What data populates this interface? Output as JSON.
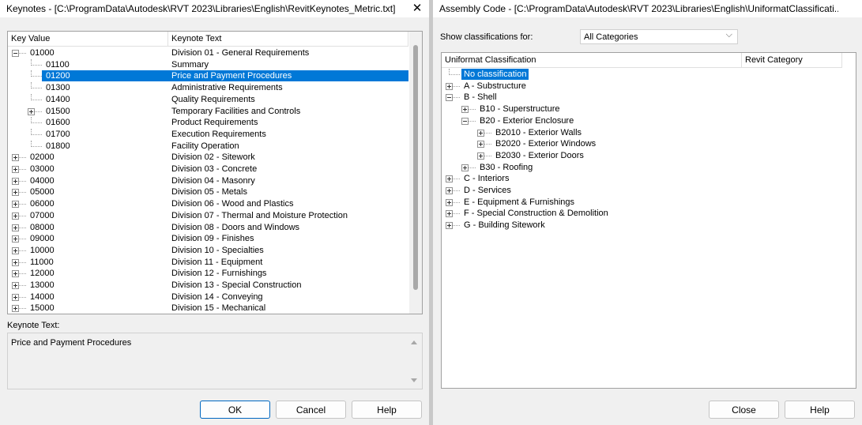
{
  "left": {
    "title": "Keynotes - [C:\\ProgramData\\Autodesk\\RVT 2023\\Libraries\\English\\RevitKeynotes_Metric.txt]",
    "columns": {
      "key": "Key Value",
      "text": "Keynote Text"
    },
    "rows": [
      {
        "key": "01000",
        "text": "Division 01 - General Requirements",
        "level": 0,
        "expander": "minus"
      },
      {
        "key": "01100",
        "text": "Summary",
        "level": 1,
        "expander": ""
      },
      {
        "key": "01200",
        "text": "Price and Payment Procedures",
        "level": 1,
        "expander": "",
        "selected": true
      },
      {
        "key": "01300",
        "text": "Administrative Requirements",
        "level": 1,
        "expander": ""
      },
      {
        "key": "01400",
        "text": "Quality Requirements",
        "level": 1,
        "expander": ""
      },
      {
        "key": "01500",
        "text": "Temporary Facilities and Controls",
        "level": 1,
        "expander": "plus"
      },
      {
        "key": "01600",
        "text": "Product Requirements",
        "level": 1,
        "expander": ""
      },
      {
        "key": "01700",
        "text": "Execution Requirements",
        "level": 1,
        "expander": ""
      },
      {
        "key": "01800",
        "text": "Facility Operation",
        "level": 1,
        "expander": ""
      },
      {
        "key": "02000",
        "text": "Division 02 - Sitework",
        "level": 0,
        "expander": "plus"
      },
      {
        "key": "03000",
        "text": "Division 03 - Concrete",
        "level": 0,
        "expander": "plus"
      },
      {
        "key": "04000",
        "text": "Division 04 - Masonry",
        "level": 0,
        "expander": "plus"
      },
      {
        "key": "05000",
        "text": "Division 05 - Metals",
        "level": 0,
        "expander": "plus"
      },
      {
        "key": "06000",
        "text": "Division 06 - Wood and Plastics",
        "level": 0,
        "expander": "plus"
      },
      {
        "key": "07000",
        "text": "Division 07 - Thermal and Moisture Protection",
        "level": 0,
        "expander": "plus"
      },
      {
        "key": "08000",
        "text": "Division 08 - Doors and Windows",
        "level": 0,
        "expander": "plus"
      },
      {
        "key": "09000",
        "text": "Division 09 - Finishes",
        "level": 0,
        "expander": "plus"
      },
      {
        "key": "10000",
        "text": "Division 10 - Specialties",
        "level": 0,
        "expander": "plus"
      },
      {
        "key": "11000",
        "text": "Division 11 - Equipment",
        "level": 0,
        "expander": "plus"
      },
      {
        "key": "12000",
        "text": "Division 12 - Furnishings",
        "level": 0,
        "expander": "plus"
      },
      {
        "key": "13000",
        "text": "Division 13 - Special Construction",
        "level": 0,
        "expander": "plus"
      },
      {
        "key": "14000",
        "text": "Division 14 - Conveying",
        "level": 0,
        "expander": "plus"
      },
      {
        "key": "15000",
        "text": "Division 15 - Mechanical",
        "level": 0,
        "expander": "plus"
      }
    ],
    "keynote_text_label": "Keynote Text:",
    "keynote_text_value": "Price and Payment Procedures",
    "buttons": {
      "ok": "OK",
      "cancel": "Cancel",
      "help": "Help"
    }
  },
  "right": {
    "title": "Assembly Code - [C:\\ProgramData\\Autodesk\\RVT 2023\\Libraries\\English\\UniformatClassificati...",
    "show_label": "Show classifications for:",
    "show_value": "All Categories",
    "columns": {
      "classification": "Uniformat Classification",
      "category": "Revit Category"
    },
    "rows": [
      {
        "text": "No classification",
        "level": 0,
        "expander": "",
        "selected": true
      },
      {
        "text": "A - Substructure",
        "level": 0,
        "expander": "plus"
      },
      {
        "text": "B - Shell",
        "level": 0,
        "expander": "minus"
      },
      {
        "text": "B10 - Superstructure",
        "level": 1,
        "expander": "plus"
      },
      {
        "text": "B20 - Exterior Enclosure",
        "level": 1,
        "expander": "minus"
      },
      {
        "text": "B2010 - Exterior Walls",
        "level": 2,
        "expander": "plus"
      },
      {
        "text": "B2020 - Exterior Windows",
        "level": 2,
        "expander": "plus"
      },
      {
        "text": "B2030 - Exterior Doors",
        "level": 2,
        "expander": "plus"
      },
      {
        "text": "B30 - Roofing",
        "level": 1,
        "expander": "plus"
      },
      {
        "text": "C - Interiors",
        "level": 0,
        "expander": "plus"
      },
      {
        "text": "D - Services",
        "level": 0,
        "expander": "plus"
      },
      {
        "text": "E - Equipment & Furnishings",
        "level": 0,
        "expander": "plus"
      },
      {
        "text": "F - Special Construction & Demolition",
        "level": 0,
        "expander": "plus"
      },
      {
        "text": "G - Building Sitework",
        "level": 0,
        "expander": "plus"
      }
    ],
    "buttons": {
      "close": "Close",
      "help": "Help"
    }
  },
  "colors": {
    "selection": "#0078d7",
    "accent_border": "#0067c0"
  }
}
